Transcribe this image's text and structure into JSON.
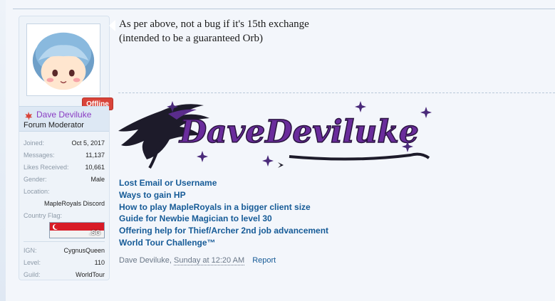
{
  "message": {
    "lines": [
      "As per above, not a bug if it's 15th exchange",
      "(intended to be a guaranteed Orb)"
    ]
  },
  "author": {
    "status_badge": "Offline",
    "username": "Dave Deviluke",
    "title": "Forum Moderator",
    "stats": {
      "joined_label": "Joined:",
      "joined": "Oct 5, 2017",
      "messages_label": "Messages:",
      "messages": "11,137",
      "likes_label": "Likes Received:",
      "likes": "10,661",
      "gender_label": "Gender:",
      "gender": "Male",
      "location_label": "Location:",
      "location": "MapleRoyals Discord",
      "flag_label": "Country Flag:",
      "flag_code": ".SG",
      "ign_label": "IGN:",
      "ign": "CygnusQueen",
      "level_label": "Level:",
      "level": "110",
      "guild_label": "Guild:",
      "guild": "WorldTour"
    }
  },
  "signature": {
    "banner_text": "DaveDeviluke",
    "links": [
      "Lost Email or Username",
      "Ways to gain HP",
      "How to play MapleRoyals in a bigger client size",
      "Guide for Newbie Magician to level 30",
      "Offering help for Thief/Archer 2nd job advancement",
      "World Tour Challenge™"
    ]
  },
  "post_meta": {
    "author": "Dave Deviluke,",
    "time": "Sunday at 12:20 AM",
    "report": "Report"
  },
  "colors": {
    "username": "#8a3cc3",
    "link": "#165b97",
    "badge": "#d9443a",
    "banner_purple": "#6a2c9c"
  }
}
